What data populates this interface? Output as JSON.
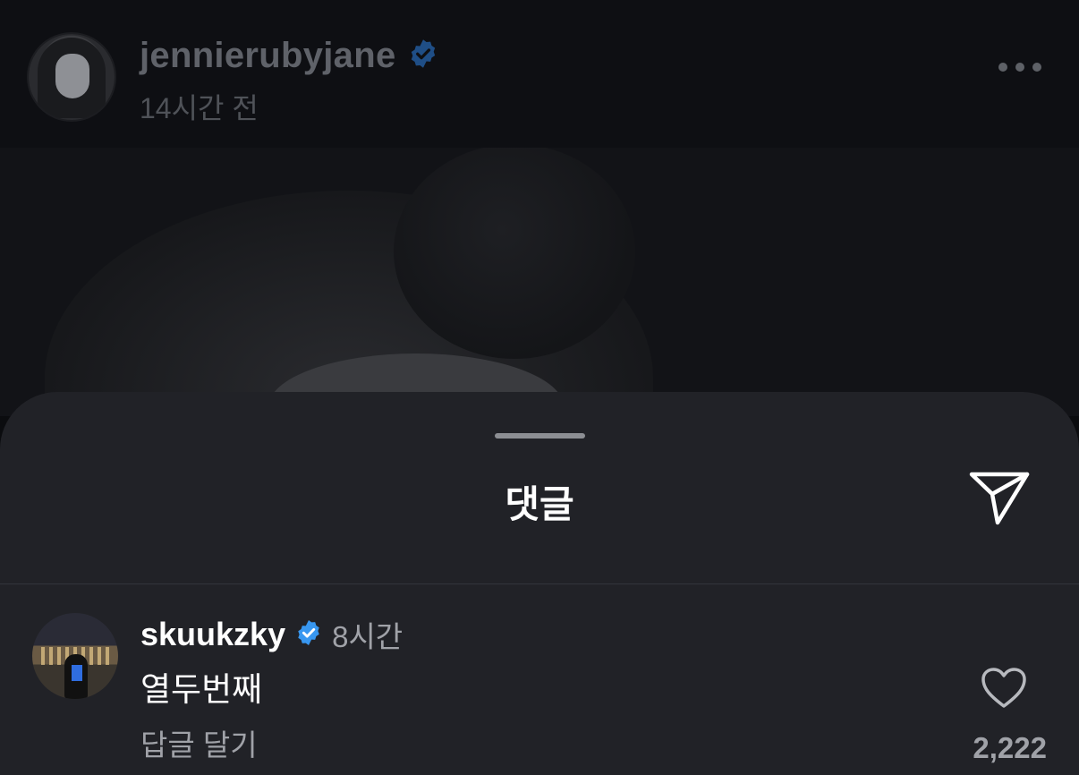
{
  "post": {
    "username": "jennierubyjane",
    "verified": true,
    "time": "14시간 전",
    "more_icon": "more-horizontal-icon"
  },
  "sheet": {
    "title": "댓글",
    "share_icon": "send-icon"
  },
  "comments": [
    {
      "username": "skuukzky",
      "verified": true,
      "time": "8시간",
      "text": "열두번째",
      "reply_label": "답글 달기",
      "likes": "2,222",
      "like_icon": "heart-outline-icon"
    }
  ],
  "colors": {
    "sheet_bg": "#212227",
    "verified_badge": "#3897f0",
    "secondary_text": "#a0a2a8"
  }
}
